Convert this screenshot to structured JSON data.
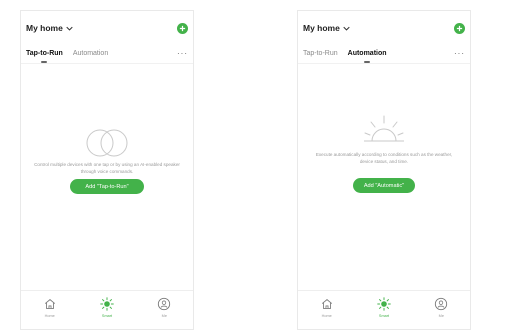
{
  "colors": {
    "accent": "#43b24a",
    "icon_gray": "#7a7a7a",
    "illustration_gray": "#c9c9c9"
  },
  "screens": [
    {
      "home_title": "My home",
      "tabs": [
        {
          "label": "Tap-to-Run",
          "active": true
        },
        {
          "label": "Automation",
          "active": false
        }
      ],
      "more_label": "···",
      "empty_state": {
        "illustration": "two-circles-icon",
        "text": "Control multiple devices with one tap or by using an AI-enabled speaker through voice commands.",
        "button_label": "Add \"Tap-to-Run\""
      },
      "nav": [
        {
          "label": "Home",
          "icon": "home-icon",
          "active": false
        },
        {
          "label": "Smart",
          "icon": "sun-icon",
          "active": true
        },
        {
          "label": "Me",
          "icon": "profile-icon",
          "active": false
        }
      ]
    },
    {
      "home_title": "My home",
      "tabs": [
        {
          "label": "Tap-to-Run",
          "active": false
        },
        {
          "label": "Automation",
          "active": true
        }
      ],
      "more_label": "···",
      "empty_state": {
        "illustration": "sunrise-icon",
        "text": "Execute automatically according to conditions such as the weather, device status, and time.",
        "button_label": "Add \"Automatic\""
      },
      "nav": [
        {
          "label": "Home",
          "icon": "home-icon",
          "active": false
        },
        {
          "label": "Smart",
          "icon": "sun-icon",
          "active": true
        },
        {
          "label": "Me",
          "icon": "profile-icon",
          "active": false
        }
      ]
    }
  ]
}
